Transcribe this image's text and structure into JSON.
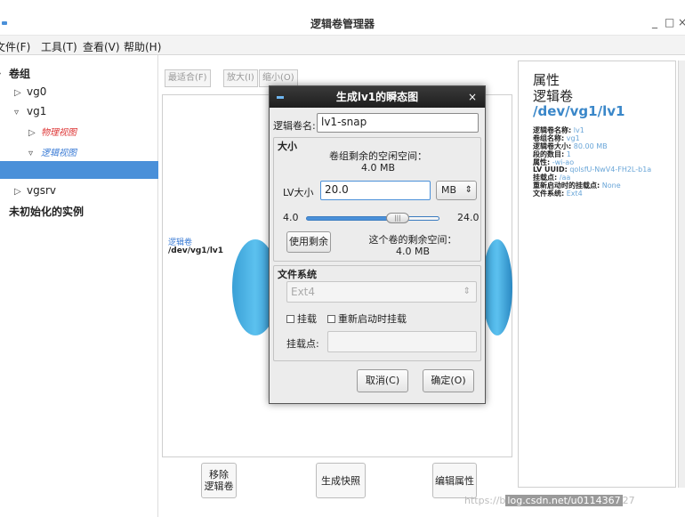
{
  "window": {
    "title": "逻辑卷管理器",
    "controls": [
      "_",
      "□",
      "×"
    ]
  },
  "menu": [
    {
      "label": "文件(F)"
    },
    {
      "label": "工具(T)"
    },
    {
      "label": "查看(V)"
    },
    {
      "label": "帮助(H)"
    }
  ],
  "tree": {
    "volume_groups": "卷组",
    "vg0": "vg0",
    "vg1": "vg1",
    "physical_view": "物理视图",
    "logical_view": "逻辑视图",
    "vgsrv": "vgsrv",
    "uninitialized": "未初始化的实例"
  },
  "toolbar": {
    "best_fit": "最适合(F)",
    "zoom_in": "放大(I)",
    "zoom_out": "缩小(O)"
  },
  "canvas": {
    "lv_label": "逻辑卷",
    "lv_path": "/dev/vg1/lv1"
  },
  "bottom_buttons": {
    "remove_line1": "移除",
    "remove_line2": "逻辑卷",
    "snapshot": "生成快照",
    "edit_props": "编辑属性"
  },
  "properties": {
    "heading": "属性",
    "type": "逻辑卷",
    "path": "/dev/vg1/lv1",
    "rows": [
      {
        "key": "逻辑卷名称:",
        "value": "lv1"
      },
      {
        "key": "卷组名称:",
        "value": "vg1"
      },
      {
        "key": "逻辑卷大小:",
        "value": "80.00 MB"
      },
      {
        "key": "段的数目:",
        "value": "1"
      },
      {
        "key": "属性:",
        "value": "-wi-ao"
      },
      {
        "key": "LV UUID:",
        "value": "qolsfU-NwV4-FH2L-b1a"
      },
      {
        "key": "挂载点:",
        "value": "/aa"
      },
      {
        "key": "重新启动时的挂载点:",
        "value": "None"
      },
      {
        "key": "文件系统:",
        "value": "Ext4"
      }
    ]
  },
  "dialog": {
    "title": "生成lv1的瞬态图",
    "close": "×",
    "name_label": "逻辑卷名:",
    "name_value": "lv1-snap",
    "size_group": "大小",
    "vg_free_label": "卷组剩余的空闲空间：",
    "vg_free_value": "4.0 MB",
    "lv_size_label": "LV大小",
    "lv_size_value": "20.0",
    "unit": "MB",
    "slider_min": "4.0",
    "slider_max": "24.0",
    "slider_position": 0.72,
    "use_remaining": "使用剩余",
    "vol_free_label": "这个卷的剩余空间：",
    "vol_free_value": "4.0 MB",
    "fs_group": "文件系统",
    "fs_value": "Ext4",
    "mount_label": "挂载",
    "remount_label": "重新启动时挂载",
    "mount_point_label": "挂载点:",
    "mount_point_value": "",
    "cancel": "取消(C)",
    "ok": "确定(O)"
  },
  "watermark": {
    "prefix": "https://b",
    "highlight": "log.csdn.net/u0114367",
    "suffix": "27"
  },
  "colors": {
    "accent": "#4a90d9",
    "cylinder": "#3aa0d6",
    "dialog_title": "#2a2a2a"
  }
}
